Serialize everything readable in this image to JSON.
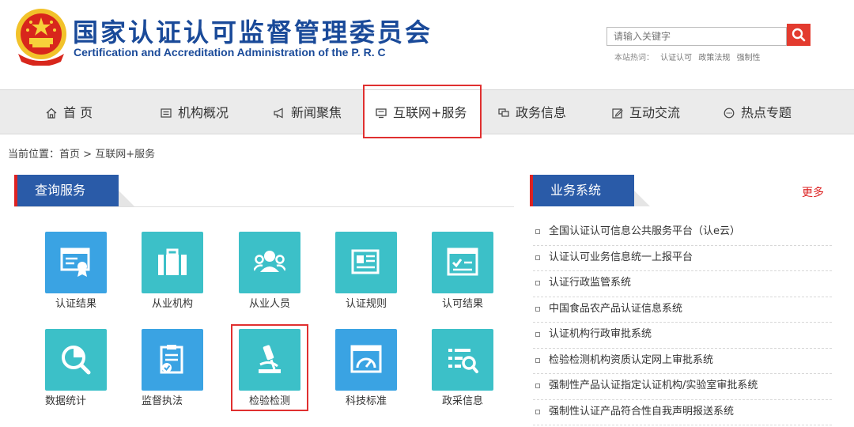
{
  "header": {
    "title_cn": "国家认证认可监督管理委员会",
    "title_en": "Certification and Accreditation Administration of the P. R. C",
    "search_placeholder": "请输入关键字",
    "hot_label": "本站热词：",
    "hot_words": [
      "认证认可",
      "政策法规",
      "强制性"
    ]
  },
  "nav": {
    "items": [
      {
        "label": "首 页",
        "icon": "home-icon"
      },
      {
        "label": "机构概况",
        "icon": "list-icon"
      },
      {
        "label": "新闻聚焦",
        "icon": "megaphone-icon"
      },
      {
        "label": "互联网+服务",
        "icon": "monitor-icon"
      },
      {
        "label": "政务信息",
        "icon": "flag-icon"
      },
      {
        "label": "互动交流",
        "icon": "edit-icon"
      },
      {
        "label": "热点专题",
        "icon": "chat-icon"
      }
    ],
    "active_index": 3
  },
  "breadcrumb": {
    "prefix": "当前位置：",
    "home": "首页",
    "sep": ">",
    "current": "互联网+服务"
  },
  "query_services": {
    "title": "查询服务",
    "tiles": [
      {
        "label": "认证结果",
        "icon": "certificate-icon"
      },
      {
        "label": "从业机构",
        "icon": "briefcase-icon"
      },
      {
        "label": "从业人员",
        "icon": "people-icon"
      },
      {
        "label": "认证规则",
        "icon": "id-card-icon"
      },
      {
        "label": "认可结果",
        "icon": "checklist-icon"
      },
      {
        "label": "数据统计",
        "icon": "chart-search-icon"
      },
      {
        "label": "监督执法",
        "icon": "clipboard-check-icon"
      },
      {
        "label": "检验检测",
        "icon": "microscope-icon"
      },
      {
        "label": "科技标准",
        "icon": "gauge-window-icon"
      },
      {
        "label": "政采信息",
        "icon": "list-search-icon"
      }
    ]
  },
  "business_systems": {
    "title": "业务系统",
    "more": "更多",
    "items": [
      "全国认证认可信息公共服务平台（认e云）",
      "认证认可业务信息统一上报平台",
      "认证行政监管系统",
      "中国食品农产品认证信息系统",
      "认证机构行政审批系统",
      "检验检测机构资质认定网上审批系统",
      "强制性产品认证指定认证机构/实验室审批系统",
      "强制性认证产品符合性自我声明报送系统"
    ]
  },
  "colors": {
    "brand_blue": "#1a4a99",
    "tile_blue": "#3aa3e3",
    "tile_teal": "#3cc0c8",
    "accent_red": "#e03030"
  }
}
